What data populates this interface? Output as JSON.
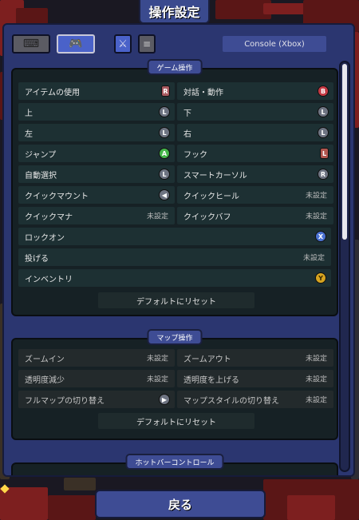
{
  "title": "操作設定",
  "top_bar": {
    "keyboard_icon": "keyboard-icon",
    "gamepad_icon": "gamepad-icon",
    "sword_glyph": "⚔",
    "list_glyph": "≡",
    "profile": "Console (Xbox)"
  },
  "game_section": {
    "label": "ゲーム操作",
    "rows": [
      {
        "label": "アイテムの使用",
        "badge": "R"
      },
      {
        "label": "対話・動作",
        "badge": "B"
      },
      {
        "label": "上",
        "badge": "L"
      },
      {
        "label": "下",
        "badge": "L"
      },
      {
        "label": "左",
        "badge": "L"
      },
      {
        "label": "右",
        "badge": "L"
      },
      {
        "label": "ジャンプ",
        "badge": "A"
      },
      {
        "label": "フック",
        "badge": "L"
      },
      {
        "label": "自動選択",
        "badge": "L"
      },
      {
        "label": "スマートカーソル",
        "badge": "R"
      },
      {
        "label": "クイックマウント",
        "badge": "◀"
      },
      {
        "label": "クイックヒール",
        "value": "未設定"
      },
      {
        "label": "クイックマナ",
        "value": "未設定"
      },
      {
        "label": "クイックバフ",
        "value": "未設定"
      },
      {
        "label": "ロックオン",
        "badge": "X"
      },
      {
        "label": "投げる",
        "value": "未設定"
      },
      {
        "label": "インベントリ",
        "badge": "Y"
      }
    ],
    "reset": "デフォルトにリセット"
  },
  "map_section": {
    "label": "マップ操作",
    "rows": [
      {
        "label": "ズームイン",
        "value": "未設定"
      },
      {
        "label": "ズームアウト",
        "value": "未設定"
      },
      {
        "label": "透明度減少",
        "value": "未設定"
      },
      {
        "label": "透明度を上げる",
        "value": "未設定"
      },
      {
        "label": "フルマップの切り替え",
        "badge": "▶"
      },
      {
        "label": "マップスタイルの切り替え",
        "value": "未設定"
      }
    ],
    "reset": "デフォルトにリセット"
  },
  "hotbar_section": {
    "label": "ホットバーコントロール"
  },
  "back_button": "戻る",
  "colors": {
    "panel": "#2b3670",
    "section": "#162125",
    "row": "#1d3033",
    "accent": "#3e4c94"
  }
}
